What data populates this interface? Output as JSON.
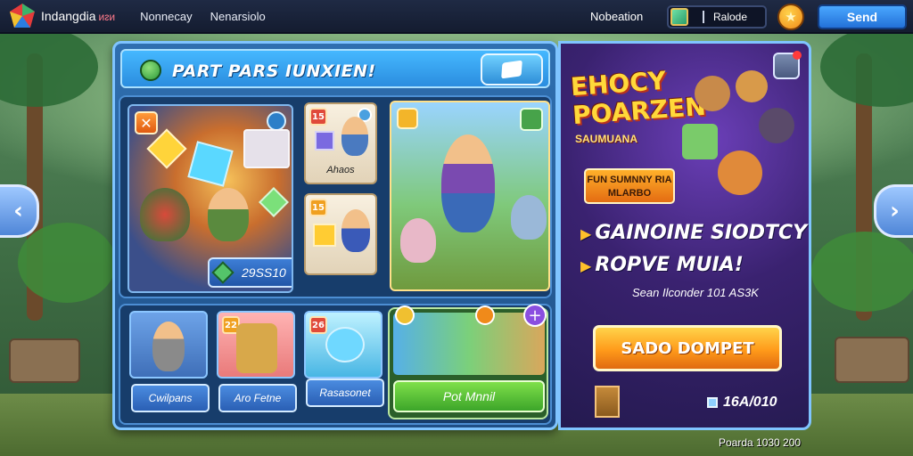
{
  "topbar": {
    "brand": "Indangdia",
    "brand_tag": "ᴎᴤᴎ",
    "nav": [
      "Nonnecay",
      "Nenarsiolo"
    ],
    "right_label": "Nobeation",
    "currency_amount": "Ralode",
    "send_label": "Send"
  },
  "panel": {
    "title": "PART PARS IUNXIEN!",
    "big_card_price": "29SS10",
    "mini_cards": [
      {
        "badge": "15",
        "label": "Ahaos"
      },
      {
        "badge": "15",
        "label": ""
      }
    ],
    "items": [
      {
        "badge": "",
        "label": "Cwilpans"
      },
      {
        "badge": "22",
        "label": "Aro Fetne"
      },
      {
        "badge": "26",
        "label": "Rasasonet"
      }
    ],
    "featured": {
      "label": "Pot Mnnil"
    }
  },
  "promo": {
    "title": "EHOCY POARZEN",
    "subtitle": "SAUMUANA",
    "tag": "FUN SUMNNY RIA MLARBO",
    "headline_1": "GAINOINE SIODTCY",
    "headline_2": "ROPVE MUIA!",
    "info": "Sean Ilconder 101 AS3K",
    "button": "SADO DOMPET",
    "price": "16A/010"
  },
  "footer": "Poarda 1030 200",
  "colors": {
    "topbar": "#1f2a44",
    "panel": "#2f6fb0",
    "accent_orange": "#ff9a1a",
    "accent_green": "#3ca52a",
    "accent_blue": "#2371d8"
  },
  "icons": {
    "logo": "colorful-diamond-logo",
    "coin": "coin-icon",
    "gem": "gem-icon",
    "arrow_left": "chevron-left-icon",
    "arrow_right": "chevron-right-icon",
    "gift": "gift-icon"
  }
}
